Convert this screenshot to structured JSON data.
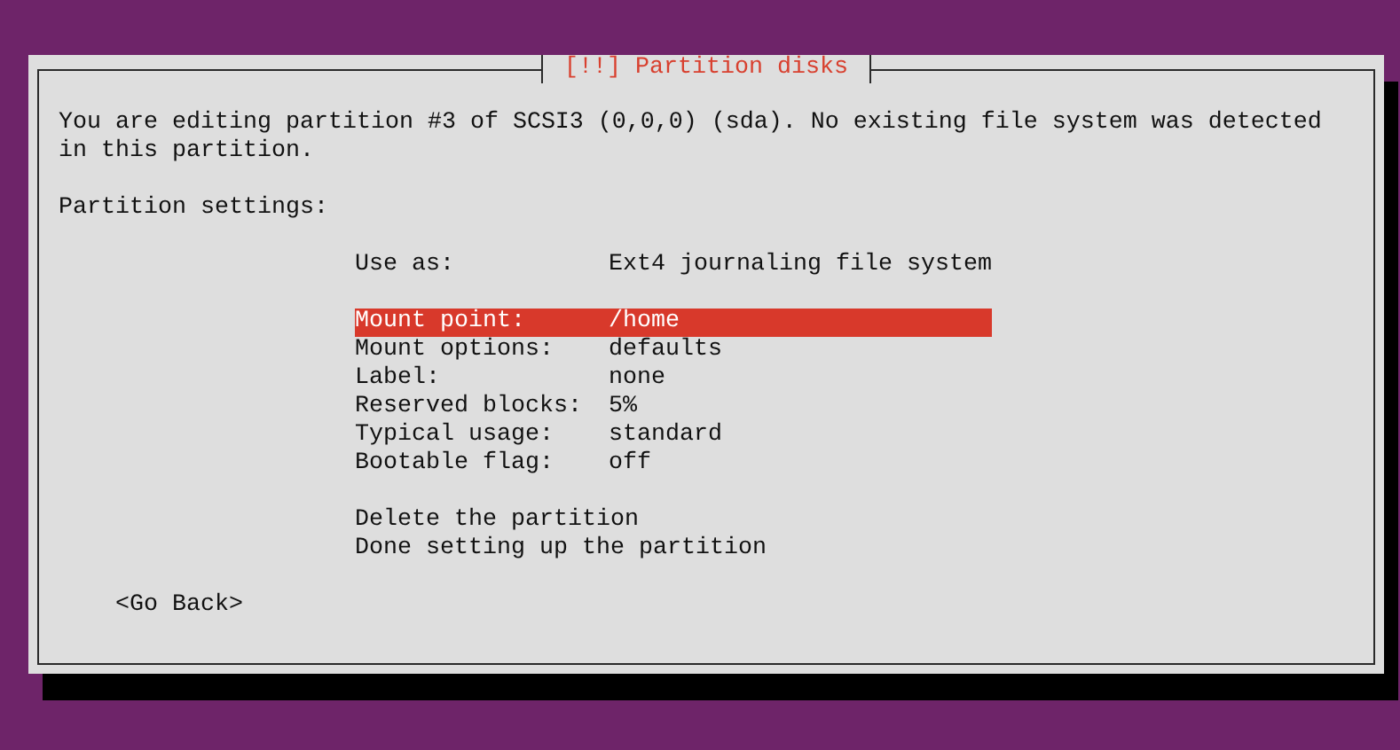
{
  "dialog": {
    "title": "[!!] Partition disks",
    "message": "You are editing partition #3 of SCSI3 (0,0,0) (sda). No existing file system was detected in this partition.",
    "section_label": "Partition settings:",
    "setting_groups": [
      [
        {
          "label": "Use as:",
          "value": "Ext4 journaling file system",
          "selected": false
        }
      ],
      [
        {
          "label": "Mount point:",
          "value": "/home",
          "selected": true
        },
        {
          "label": "Mount options:",
          "value": "defaults",
          "selected": false
        },
        {
          "label": "Label:",
          "value": "none",
          "selected": false
        },
        {
          "label": "Reserved blocks:",
          "value": "5%",
          "selected": false
        },
        {
          "label": "Typical usage:",
          "value": "standard",
          "selected": false
        },
        {
          "label": "Bootable flag:",
          "value": "off",
          "selected": false
        }
      ]
    ],
    "actions": [
      {
        "label": "Delete the partition",
        "selected": false
      },
      {
        "label": "Done setting up the partition",
        "selected": false
      }
    ],
    "back_button": {
      "label": "<Go Back>"
    }
  }
}
